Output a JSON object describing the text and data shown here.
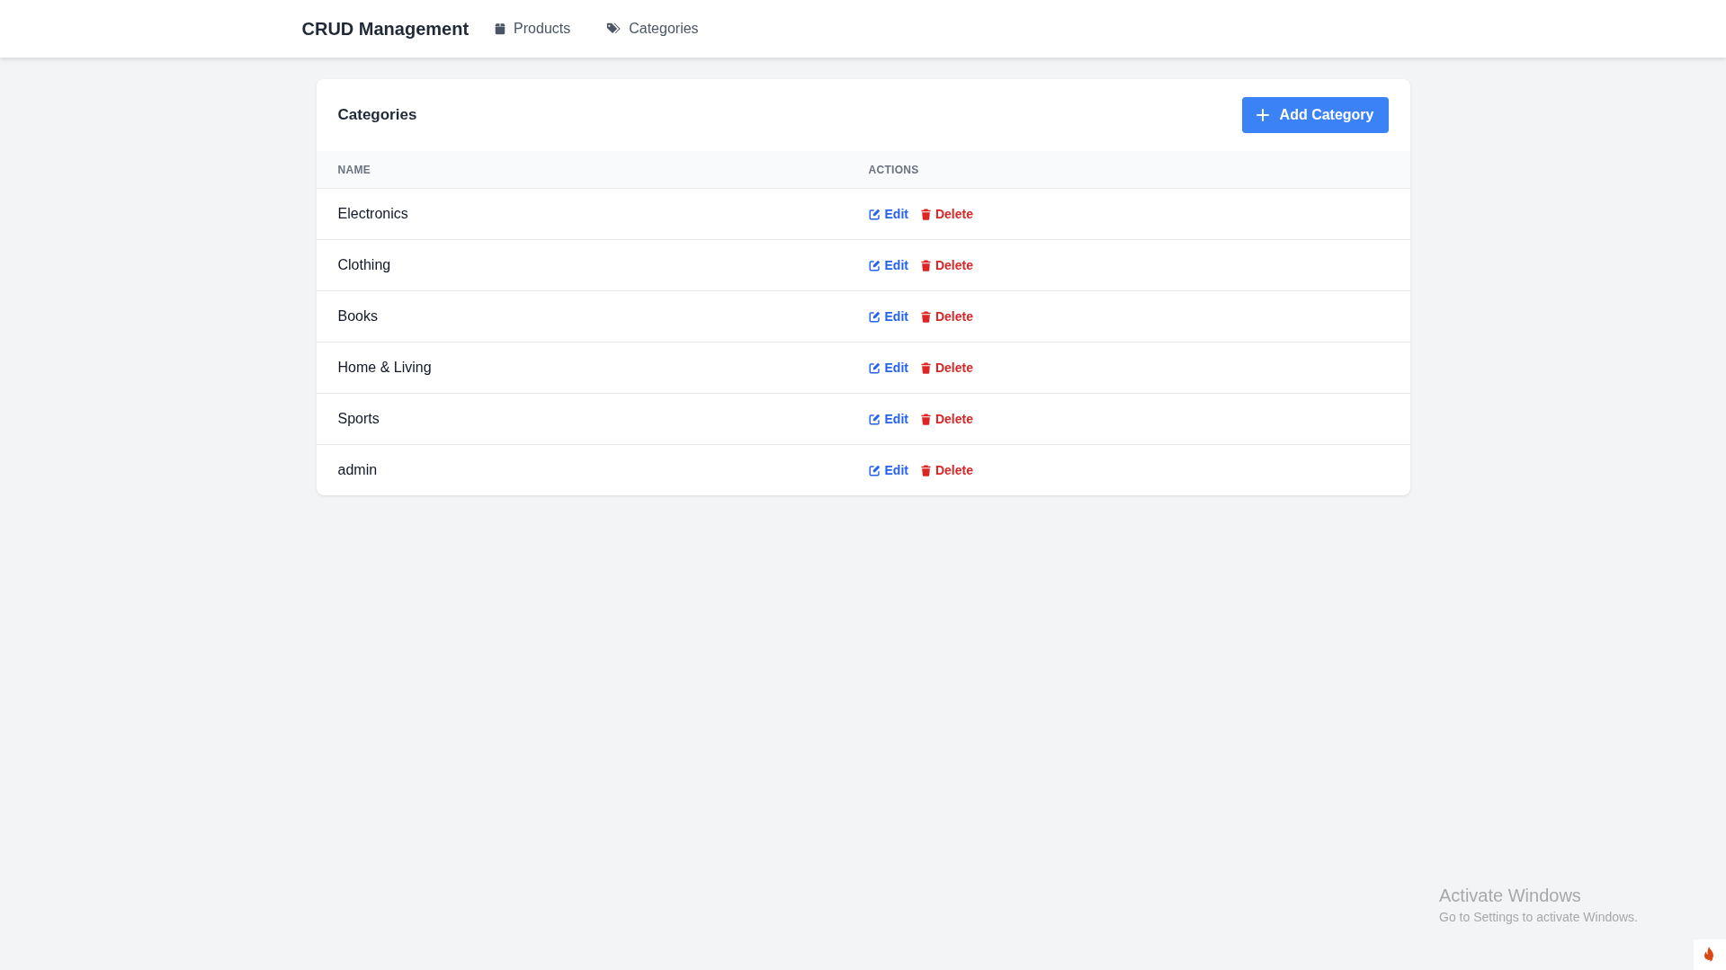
{
  "navbar": {
    "brand": "CRUD Management",
    "links": [
      {
        "label": "Products",
        "kind": "products"
      },
      {
        "label": "Categories",
        "kind": "categories"
      }
    ]
  },
  "card": {
    "title": "Categories",
    "add_button": "Add Category",
    "table": {
      "columns": [
        "NAME",
        "ACTIONS"
      ],
      "rows": [
        {
          "name": "Electronics",
          "edit": "Edit",
          "delete": "Delete"
        },
        {
          "name": "Clothing",
          "edit": "Edit",
          "delete": "Delete"
        },
        {
          "name": "Books",
          "edit": "Edit",
          "delete": "Delete"
        },
        {
          "name": "Home & Living",
          "edit": "Edit",
          "delete": "Delete"
        },
        {
          "name": "Sports",
          "edit": "Edit",
          "delete": "Delete"
        },
        {
          "name": "admin",
          "edit": "Edit",
          "delete": "Delete"
        }
      ]
    }
  },
  "os_overlay": {
    "title": "Activate Windows",
    "subtitle": "Go to Settings to activate Windows."
  }
}
